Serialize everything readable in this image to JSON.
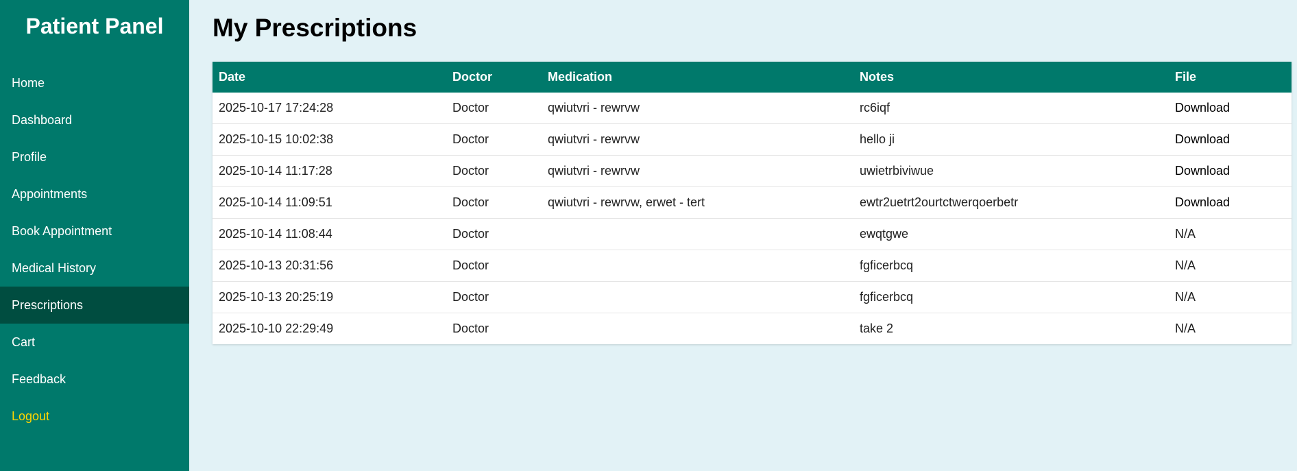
{
  "sidebar": {
    "title": "Patient Panel",
    "items": [
      {
        "label": "Home"
      },
      {
        "label": "Dashboard"
      },
      {
        "label": "Profile"
      },
      {
        "label": "Appointments"
      },
      {
        "label": "Book Appointment"
      },
      {
        "label": "Medical History"
      },
      {
        "label": "Prescriptions"
      },
      {
        "label": "Cart"
      },
      {
        "label": "Feedback"
      },
      {
        "label": "Logout"
      }
    ],
    "active": "Prescriptions"
  },
  "main": {
    "title": "My Prescriptions",
    "table": {
      "headers": [
        "Date",
        "Doctor",
        "Medication",
        "Notes",
        "File"
      ],
      "rows": [
        {
          "date": "2025-10-17 17:24:28",
          "doctor": "Doctor",
          "medication": "qwiutvri - rewrvw",
          "notes": "rc6iqf",
          "file": "Download"
        },
        {
          "date": "2025-10-15 10:02:38",
          "doctor": "Doctor",
          "medication": "qwiutvri - rewrvw",
          "notes": "hello ji",
          "file": "Download"
        },
        {
          "date": "2025-10-14 11:17:28",
          "doctor": "Doctor",
          "medication": "qwiutvri - rewrvw",
          "notes": "uwietrbiviwue",
          "file": "Download"
        },
        {
          "date": "2025-10-14 11:09:51",
          "doctor": "Doctor",
          "medication": "qwiutvri - rewrvw, erwet - tert",
          "notes": "ewtr2uetrt2ourtctwerqoerbetr",
          "file": "Download"
        },
        {
          "date": "2025-10-14 11:08:44",
          "doctor": "Doctor",
          "medication": "",
          "notes": "ewqtgwe",
          "file": "N/A"
        },
        {
          "date": "2025-10-13 20:31:56",
          "doctor": "Doctor",
          "medication": "",
          "notes": "fgficerbcq",
          "file": "N/A"
        },
        {
          "date": "2025-10-13 20:25:19",
          "doctor": "Doctor",
          "medication": "",
          "notes": "fgficerbcq",
          "file": "N/A"
        },
        {
          "date": "2025-10-10 22:29:49",
          "doctor": "Doctor",
          "medication": "",
          "notes": "take 2",
          "file": "N/A"
        }
      ]
    }
  },
  "colors": {
    "sidebar_bg": "#00796b",
    "active_item_bg": "#004d40",
    "logout": "#ffd600",
    "page_bg": "#e2f2f6",
    "table_header_bg": "#00796b"
  }
}
